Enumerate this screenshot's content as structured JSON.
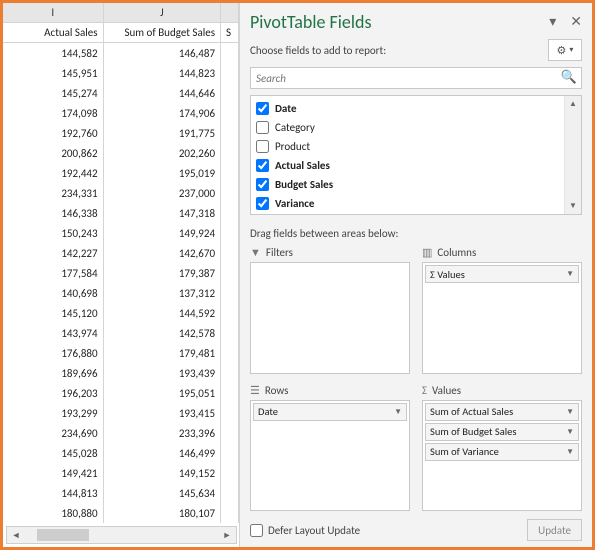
{
  "sheet": {
    "cols": [
      "I",
      "J"
    ],
    "field_headers": [
      "Actual Sales",
      "Sum of Budget Sales",
      "S"
    ],
    "rows": [
      [
        "144,582",
        "146,487"
      ],
      [
        "145,951",
        "144,823"
      ],
      [
        "145,274",
        "144,646"
      ],
      [
        "174,098",
        "174,906"
      ],
      [
        "192,760",
        "191,775"
      ],
      [
        "200,862",
        "202,260"
      ],
      [
        "192,442",
        "195,019"
      ],
      [
        "234,331",
        "237,000"
      ],
      [
        "146,338",
        "147,318"
      ],
      [
        "150,243",
        "149,924"
      ],
      [
        "142,227",
        "142,670"
      ],
      [
        "177,584",
        "179,387"
      ],
      [
        "140,698",
        "137,312"
      ],
      [
        "145,120",
        "144,592"
      ],
      [
        "143,974",
        "142,578"
      ],
      [
        "176,880",
        "179,481"
      ],
      [
        "189,696",
        "193,439"
      ],
      [
        "196,203",
        "195,051"
      ],
      [
        "193,299",
        "193,415"
      ],
      [
        "234,690",
        "233,396"
      ],
      [
        "145,028",
        "146,499"
      ],
      [
        "149,421",
        "149,152"
      ],
      [
        "144,813",
        "145,634"
      ],
      [
        "180,880",
        "180,107"
      ]
    ]
  },
  "pane": {
    "title": "PivotTable Fields",
    "choose_label": "Choose fields to add to report:",
    "search_placeholder": "Search",
    "fields": [
      {
        "name": "Date",
        "checked": true,
        "bold": true
      },
      {
        "name": "Category",
        "checked": false,
        "bold": false
      },
      {
        "name": "Product",
        "checked": false,
        "bold": false
      },
      {
        "name": "Actual Sales",
        "checked": true,
        "bold": true
      },
      {
        "name": "Budget Sales",
        "checked": true,
        "bold": true
      },
      {
        "name": "Variance",
        "checked": true,
        "bold": true
      }
    ],
    "drag_label": "Drag fields between areas below:",
    "areas": {
      "filters": {
        "label": "Filters",
        "items": []
      },
      "columns": {
        "label": "Columns",
        "items": [
          "Σ Values"
        ]
      },
      "rows": {
        "label": "Rows",
        "items": [
          "Date"
        ]
      },
      "values": {
        "label": "Values",
        "items": [
          "Sum of Actual Sales",
          "Sum of Budget Sales",
          "Sum of Variance"
        ]
      }
    },
    "defer_label": "Defer Layout Update",
    "update_label": "Update"
  }
}
